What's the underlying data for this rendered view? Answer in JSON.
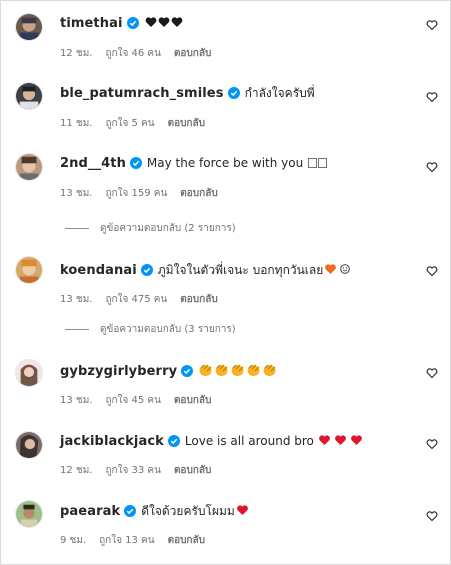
{
  "colors": {
    "verified": "#0095f6",
    "muted": "#737373",
    "heart_red": "#e0142e",
    "heart_orange": "#f26b1d",
    "heart_black": "#1a1a1a",
    "clap": "#f6b51e"
  },
  "comments": [
    {
      "username": "timethai",
      "text": "",
      "emoji": [
        "black-heart",
        "black-heart",
        "black-heart"
      ],
      "time": "12 ชม.",
      "likes": "ถูกใจ 46 คน",
      "reply": "ตอบกลับ"
    },
    {
      "username": "ble_patumrach_smiles",
      "text": "กำลังใจครับพี่",
      "emoji": [],
      "time": "11 ชม.",
      "likes": "ถูกใจ 5 คน",
      "reply": "ตอบกลับ"
    },
    {
      "username": "2nd__4th",
      "text": "May the force be with you",
      "emoji": [
        "unknown-glyph",
        "unknown-glyph"
      ],
      "time": "13 ชม.",
      "likes": "ถูกใจ 159 คน",
      "reply": "ตอบกลับ",
      "view_replies": "ดูข้อความตอบกลับ (2 รายการ)"
    },
    {
      "username": "koendanai",
      "text": "ภูมิใจในตัวพี่เจนะ บอกทุกวันเลย",
      "emoji": [
        "orange-heart",
        "smile"
      ],
      "time": "13 ชม.",
      "likes": "ถูกใจ 475 คน",
      "reply": "ตอบกลับ",
      "view_replies": "ดูข้อความตอบกลับ (3 รายการ)"
    },
    {
      "username": "gybzygirlyberry",
      "text": "",
      "emoji": [
        "clap",
        "clap",
        "clap",
        "clap",
        "clap"
      ],
      "time": "13 ชม.",
      "likes": "ถูกใจ 45 คน",
      "reply": "ตอบกลับ"
    },
    {
      "username": "jackiblackjack",
      "text": "Love is all around bro",
      "emoji": [
        "red-heart",
        "red-heart",
        "red-heart"
      ],
      "time": "12 ชม.",
      "likes": "ถูกใจ 33 คน",
      "reply": "ตอบกลับ"
    },
    {
      "username": "paearak",
      "text": "ดีใจด้วยครับโผมม",
      "emoji": [
        "red-heart"
      ],
      "time": "9 ชม.",
      "likes": "ถูกใจ 13 คน",
      "reply": "ตอบกลับ"
    }
  ]
}
